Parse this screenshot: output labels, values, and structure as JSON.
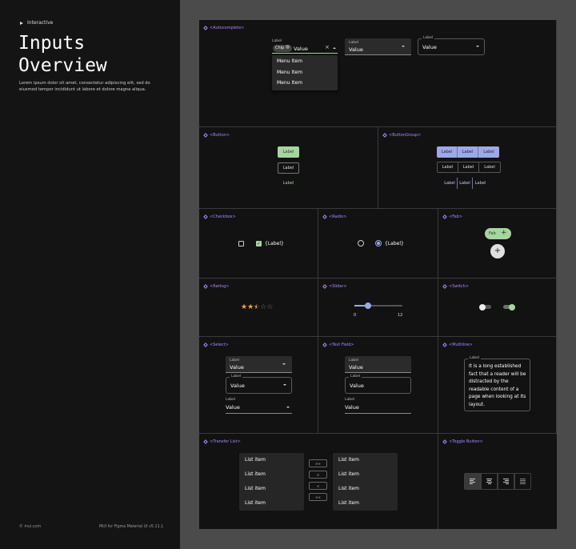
{
  "sidebar": {
    "interactive": "Interactive",
    "title_line1": "Inputs",
    "title_line2": "Overview",
    "description": "Lorem ipsum dolor sit amet, consectetur adipiscing elit, sed do eiusmod tempor incididunt ut labore et dolore magna aliqua.",
    "footer_left": "© mui.com",
    "footer_right": "MUI for Figma Material UI v5.11.1"
  },
  "colors": {
    "accent": "#a58aff",
    "green": "#a7d5a0",
    "lavender": "#9fa8e6",
    "star": "#f2a33a"
  },
  "cells": {
    "autocomplete": "<Autocomplete>",
    "button": "<Button>",
    "buttongroup": "<ButtonGroup>",
    "checkbox": "<Checkbox>",
    "radio": "<Radio>",
    "fab": "<Fab>",
    "rating": "<Rating>",
    "slider": "<Slider>",
    "switch": "<Switch>",
    "select": "<Select>",
    "textfield": "<Text Field>",
    "multiline": "<Multiline>",
    "transfer": "<Transfer List>",
    "toggle": "<Toggle Button>"
  },
  "autocomplete": {
    "label": "Label",
    "chip": "Chip",
    "value": "Value",
    "menu": [
      "Menu Item",
      "Menu Item",
      "Menu Item"
    ],
    "field2_label": "Label",
    "field2_value": "Value",
    "field3_label": "Label",
    "field3_value": "Value"
  },
  "button": {
    "contained": "Label",
    "outlined": "Label",
    "text": "Label"
  },
  "buttongroup": {
    "row1": [
      "Label",
      "Label",
      "Label"
    ],
    "row2": [
      "Label",
      "Label",
      "Label"
    ],
    "row3": [
      "Label",
      "Label",
      "Label"
    ]
  },
  "checkbox": {
    "label": "{Label}"
  },
  "radio": {
    "label": "{Label}"
  },
  "fab": {
    "extended": "Fab"
  },
  "rating": {
    "value": 2.5,
    "max": 5
  },
  "slider": {
    "min": "0",
    "max": "12",
    "value": 1.5
  },
  "select": {
    "f1_label": "Label",
    "f1_value": "Value",
    "f2_label": "Label",
    "f2_value": "Value",
    "f3_label": "Label",
    "f3_value": "Value"
  },
  "textfield": {
    "f1_label": "Label",
    "f1_value": "Value",
    "f2_label": "Label",
    "f2_value": "Value",
    "f3_label": "Label",
    "f3_value": "Value"
  },
  "multiline": {
    "label": "Label",
    "text": "It is a long established fact that a reader will be distracted by the readable content of a page when looking at its layout."
  },
  "transfer": {
    "left": [
      "List item",
      "List item",
      "List item",
      "List item"
    ],
    "right": [
      "List item",
      "List item",
      "List item",
      "List item"
    ],
    "buttons": [
      ">>",
      ">",
      "<",
      "<<"
    ]
  }
}
